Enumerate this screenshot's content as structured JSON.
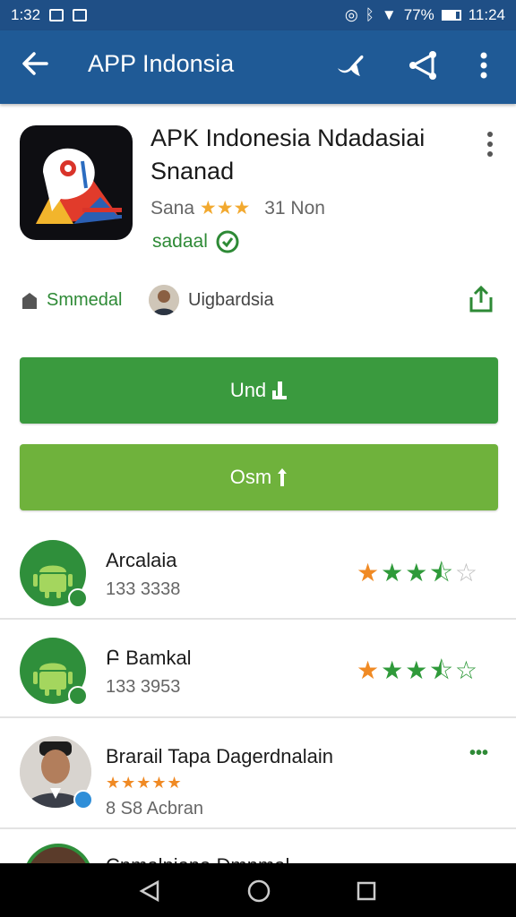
{
  "status_bar": {
    "time_left": "1:32",
    "battery": "77%",
    "time_right": "11:24"
  },
  "app_bar": {
    "title": "APP Indonsia"
  },
  "app": {
    "name_line1": "APK Indonesia Ndadasiai",
    "name_line2": "Snanad",
    "rating_text": "Sana",
    "rating_stars": "★★★",
    "rating_count": "31 Non",
    "verified_text": "sadaal",
    "developer": "Smmedal",
    "publisher": "Uigbardsia"
  },
  "buttons": {
    "primary": "Und",
    "secondary": "Osm"
  },
  "list": [
    {
      "name": "Arcalaia",
      "sub": "133 3338"
    },
    {
      "name": "Բ Bamkal",
      "sub": "133 3953"
    },
    {
      "name": "Brarail Tapa Dagerdnalain",
      "sub": "8  S8 Acbran",
      "stars": "★★★★★",
      "more": "•••"
    },
    {
      "name": "Cnmalniana Dmnmal"
    }
  ],
  "colors": {
    "app_bar": "#1f5a96",
    "status_bar": "#1f4f86",
    "primary_button": "#3a9a3e",
    "secondary_button": "#6fb23c",
    "accent_green": "#2e8a36",
    "star": "#f08a24"
  }
}
